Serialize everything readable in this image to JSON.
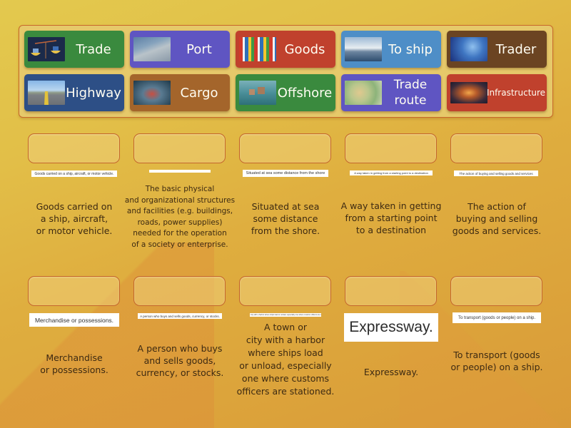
{
  "theme": {
    "tray_bg": "#e6c96a",
    "tray_border": "#c8682a",
    "slot_border": "#c4662c",
    "definition_text_color": "#3d2a12"
  },
  "tiles": [
    {
      "id": "trade",
      "label": "Trade",
      "color": "#3a8a3e",
      "image": "balance-scale-image"
    },
    {
      "id": "port",
      "label": "Port",
      "color": "#5f55c2",
      "image": "port-aerial-image"
    },
    {
      "id": "goods",
      "label": "Goods",
      "color": "#c0412d",
      "image": "household-goods-image"
    },
    {
      "id": "to-ship",
      "label": "To ship",
      "color": "#4e8ec7",
      "image": "cruise-ship-image"
    },
    {
      "id": "trader",
      "label": "Trader",
      "color": "#6b4422",
      "image": "stock-trading-image"
    },
    {
      "id": "highway",
      "label": "Highway",
      "color": "#2d4f86",
      "image": "highway-road-image"
    },
    {
      "id": "cargo",
      "label": "Cargo",
      "color": "#a4652b",
      "image": "container-ship-image"
    },
    {
      "id": "offshore",
      "label": "Offshore",
      "color": "#3a8a3e",
      "image": "offshore-platform-image"
    },
    {
      "id": "trade-route",
      "label": "Trade route",
      "color": "#5f55c2",
      "image": "trade-route-map-image"
    },
    {
      "id": "infrastructure",
      "label": "Infrastructure",
      "color": "#c0412d",
      "image": "highway-interchange-image"
    }
  ],
  "targets": [
    {
      "image_text": "Goods carried on a ship, aircraft, or motor vehicle.",
      "definition": "Goods carried on\na ship, aircraft,\nor motor vehicle."
    },
    {
      "image_text": "",
      "definition": "The basic physical\nand organizational structures\nand facilities (e.g. buildings,\nroads, power supplies)\nneeded for the operation\nof a society or enterprise."
    },
    {
      "image_text": "Situated at sea some distance from the shore",
      "definition": "Situated at sea\nsome distance\nfrom the shore."
    },
    {
      "image_text": "A way taken in getting from a starting point to a destination",
      "definition": "A way taken in getting\nfrom a starting point\nto a destination"
    },
    {
      "image_text": "The action of buying and selling goods and services",
      "definition": "The action of\nbuying and selling\ngoods and services."
    },
    {
      "image_text": "Merchandise or possessions.",
      "definition": "Merchandise\nor possessions."
    },
    {
      "image_text": "A person who buys and sells goods, currency, or stocks.",
      "definition": "A person who buys\nand sells goods,\ncurrency, or stocks."
    },
    {
      "image_text": "A town or city with a harbor where ships load or unload, especially one where customs officers are stationed.",
      "definition": "A town or\ncity with a harbor\nwhere ships load\nor unload, especially\none where customs\nofficers are stationed."
    },
    {
      "image_text": "Expressway.",
      "definition": "Expressway."
    },
    {
      "image_text": "To transport (goods or people) on a ship.",
      "definition": "To transport (goods\nor people) on a ship."
    }
  ]
}
